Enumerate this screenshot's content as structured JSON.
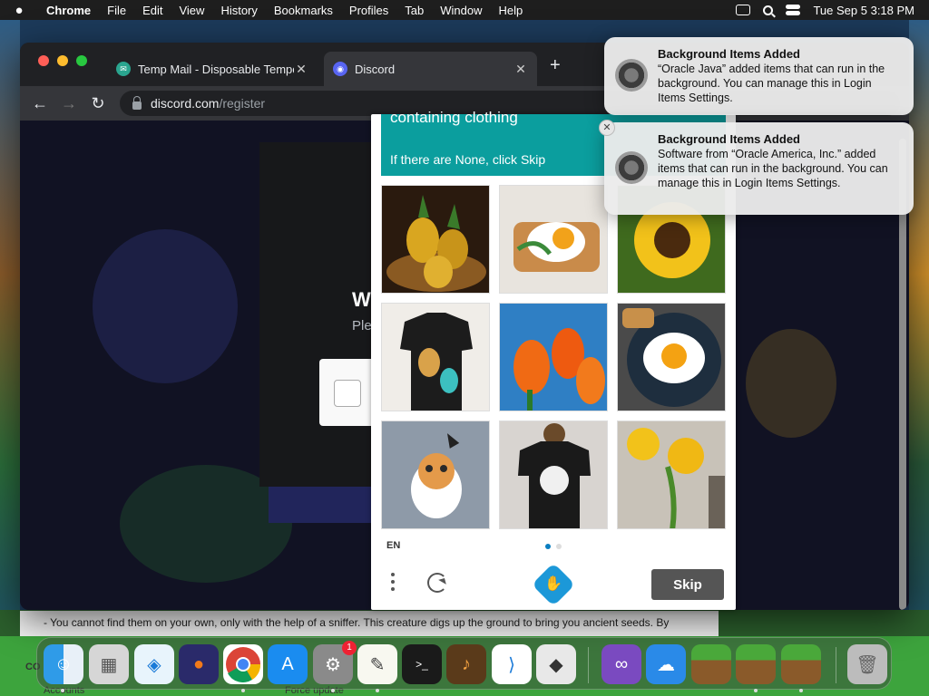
{
  "menubar": {
    "app_name": "Chrome",
    "items": [
      "File",
      "Edit",
      "View",
      "History",
      "Bookmarks",
      "Profiles",
      "Tab",
      "Window",
      "Help"
    ],
    "datetime": "Tue Sep 5  3:18 PM"
  },
  "browser": {
    "tabs": [
      {
        "title": "Temp Mail - Disposable Tempor",
        "active": false
      },
      {
        "title": "Discord",
        "active": true
      }
    ],
    "url_domain": "discord.com",
    "url_path": "/register"
  },
  "page": {
    "heading": "W",
    "subheading": "Ple"
  },
  "captcha": {
    "prompt_line1": "containing clothing",
    "prompt_line2": "If there are None, click Skip",
    "tiles": [
      {
        "name": "pineapples-in-basket",
        "subject": "pineapples"
      },
      {
        "name": "egg-on-toast",
        "subject": "toast with egg"
      },
      {
        "name": "sunflower",
        "subject": "sunflower"
      },
      {
        "name": "cat-tshirt-woman",
        "subject": "t-shirt"
      },
      {
        "name": "orange-tulips",
        "subject": "tulips"
      },
      {
        "name": "egg-toast-plate",
        "subject": "toast with egg"
      },
      {
        "name": "cat-tshirt-gray",
        "subject": "t-shirt"
      },
      {
        "name": "cat-tshirt-man",
        "subject": "t-shirt"
      },
      {
        "name": "sunflowers-vase",
        "subject": "sunflowers"
      }
    ],
    "language": "EN",
    "skip_label": "Skip"
  },
  "notifications": [
    {
      "title": "Background Items Added",
      "body": "“Oracle Java” added items that can run in the background. You can manage this in Login Items Settings."
    },
    {
      "title": "Background Items Added",
      "body": "Software from “Oracle America, Inc.” added items that can run in the background. You can manage this in Login Items Settings."
    }
  ],
  "background": {
    "text_line": "- You cannot find them on your own, only with the help of a sniffer. This creature digs up the ground to bring you ancient seeds. By",
    "bottom_left": "Accounts",
    "bottom_mid": "Force update",
    "left_fragment": "CO"
  },
  "dock": {
    "system_settings_badge": "1",
    "apps": [
      "Finder",
      "Launchpad",
      "Safari",
      "Firefox",
      "Chrome",
      "App Store",
      "System Settings",
      "TextEdit",
      "Terminal",
      "GarageBand",
      "VS Code",
      "Roblox",
      "Visual Studio",
      "Weather",
      "Minecraft",
      "Minecraft",
      "Minecraft",
      "Trash"
    ]
  },
  "colors": {
    "captcha_prompt": "#0b9e9e",
    "discord_bg": "#1f2240",
    "skip_button": "#555555"
  }
}
